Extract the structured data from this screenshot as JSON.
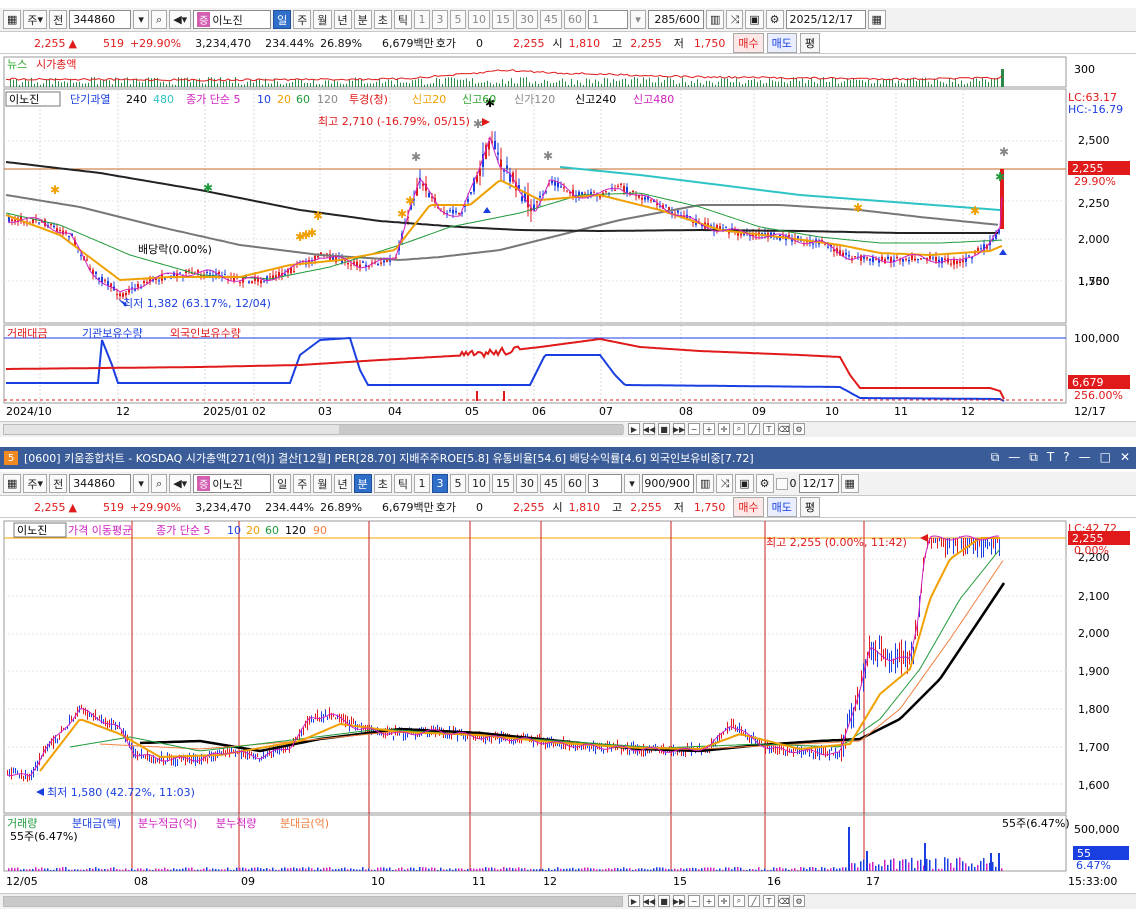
{
  "top_toolbar": {
    "market": "주",
    "prev": "전",
    "code": "344860",
    "stock_name": "이노진",
    "tabs": [
      "일",
      "주",
      "월",
      "년",
      "분",
      "초",
      "틱"
    ],
    "active_tab": "일",
    "intervals": [
      "1",
      "3",
      "5",
      "10",
      "15",
      "30",
      "45",
      "60"
    ],
    "count_value": "1",
    "bars": "285/600",
    "date": "2025/12/17"
  },
  "quote": {
    "price": "2,255",
    "change": "519",
    "change_pct": "+29.90%",
    "volume": "3,234,470",
    "vol_ratio": "234.44%",
    "turnover": "26.89%",
    "amount": "6,679백만",
    "hoga_label": "호가",
    "hoga_value": "0",
    "hoga_price": "2,255",
    "open_label": "시",
    "open": "1,810",
    "high_label": "고",
    "high": "2,255",
    "low_label": "저",
    "low": "1,750",
    "buy_label": "매수",
    "sell_label": "매도",
    "avg_label": "평"
  },
  "daily": {
    "news_legend": [
      "뉴스",
      "시가총액"
    ],
    "news_axis": "300",
    "legend": [
      "이노진",
      "단기과열",
      "240",
      "480",
      "종가 단순 5",
      "10",
      "20",
      "60",
      "120",
      "투경(청)",
      "신고20",
      "신고60",
      "신가120",
      "신고240",
      "신고480"
    ],
    "lc": "LC:63.17",
    "hc": "HC:-16.79",
    "max_label": "최고 2,710 (-16.79%, 05/15)",
    "min_label": "최저 1,382 (63.17%, 12/04)",
    "dividend_label": "배당락(0.00%)",
    "price_ticks": [
      "2,500",
      "2,250",
      "2,000",
      "1,750",
      "1,500"
    ],
    "price_tag": "2,255",
    "price_tag_pct": "29.90%",
    "vol_legend": [
      "거래대금",
      "기관보유수량",
      "외국인보유수량"
    ],
    "vol_ticks": [
      "100,000"
    ],
    "vol_tag": "6,679",
    "vol_tag_pct": "256.00%",
    "x_labels": [
      "2024/10",
      "12",
      "2025/01",
      "02",
      "03",
      "04",
      "05",
      "06",
      "07",
      "08",
      "09",
      "10",
      "11",
      "12"
    ],
    "x_end": "12/17"
  },
  "window": {
    "number": "5",
    "title": "[0600] 키움종합차트 - KOSDAQ 시가총액[271(억)] 결산[12월] PER[28.70] 지배주주ROE[5.8] 유통비율[54.6] 배당수익률[4.6] 외국인보유비중[7.72]",
    "controls": [
      "⧉",
      "—",
      "⧉",
      "T",
      "?",
      "—",
      "□",
      "✕"
    ]
  },
  "bottom_toolbar": {
    "market": "주",
    "prev": "전",
    "code": "344860",
    "stock_name": "이노진",
    "tabs": [
      "일",
      "주",
      "월",
      "년",
      "분",
      "초",
      "틱"
    ],
    "active_tab": "분",
    "intervals": [
      "1",
      "3",
      "5",
      "10",
      "15",
      "30",
      "45",
      "60"
    ],
    "active_interval": "3",
    "count_value": "3",
    "bars": "900/900",
    "check_label": "0",
    "date": "12/17"
  },
  "minute": {
    "legend": [
      "이노진",
      "가격 이동평균",
      "종가 단순 5",
      "10",
      "20",
      "60",
      "120",
      "90"
    ],
    "lc": "LC:42.72",
    "max_label": "최고 2,255 (0.00%, 11:42)",
    "min_label": "최저 1,580 (42.72%, 11:03)",
    "price_ticks": [
      "2,200",
      "2,100",
      "2,000",
      "1,900",
      "1,800",
      "1,700",
      "1,600"
    ],
    "price_tag": "2,255",
    "price_tag_pct": "0.00%",
    "vol_legend": [
      "거래량",
      "분대금(백)",
      "분누적금(억)",
      "분누적량",
      "분대금(억)"
    ],
    "vol_left": "55주(6.47%)",
    "vol_right": "55주(6.47%)",
    "vol_tick": "500,000",
    "vol_tag": "55",
    "vol_tag_pct": "6.47%",
    "x_labels": [
      "12/05",
      "08",
      "09",
      "10",
      "11",
      "12",
      "15",
      "16",
      "17"
    ],
    "x_end": "15:33:00"
  }
}
